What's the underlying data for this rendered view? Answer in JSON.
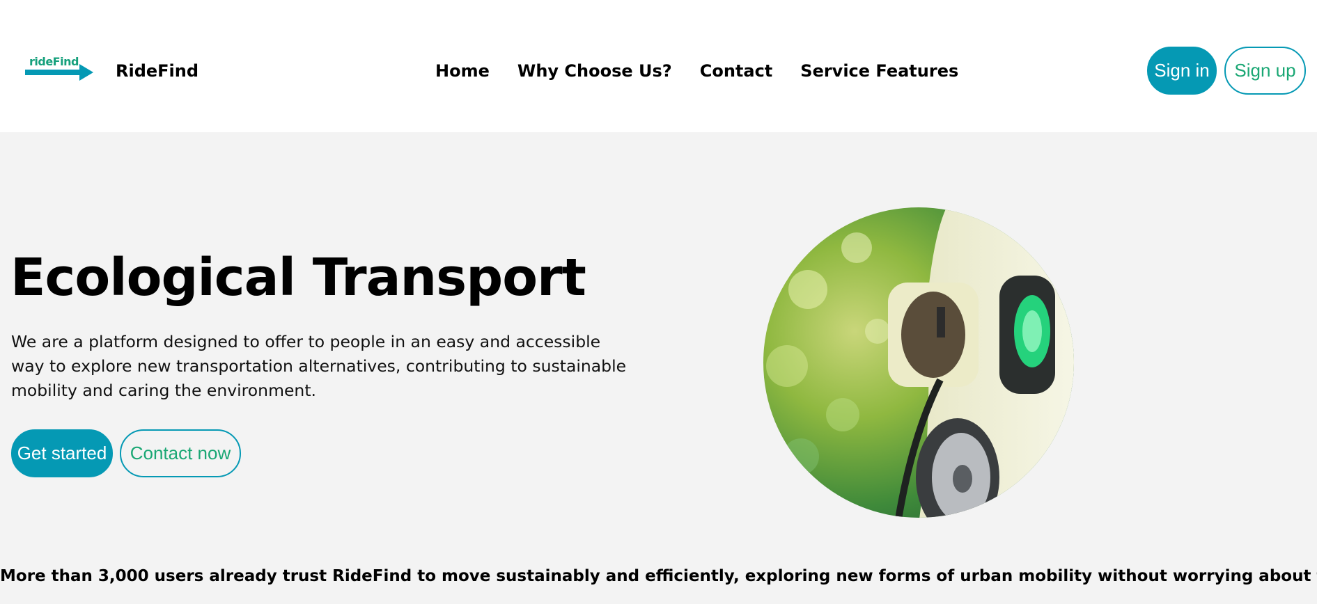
{
  "header": {
    "logo_text": "rideFind",
    "brand_name": "RideFind",
    "nav": [
      {
        "label": "Home"
      },
      {
        "label": "Why Choose Us?"
      },
      {
        "label": "Contact"
      },
      {
        "label": "Service Features"
      }
    ],
    "sign_in_label": "Sign in",
    "sign_up_label": "Sign up"
  },
  "hero": {
    "title": "Ecological Transport",
    "description": "We are a platform designed to offer to people in an easy and accessible way to explore new transportation alternatives, contributing to sustainable mobility and caring the environment.",
    "primary_cta": "Get started",
    "secondary_cta": "Contact now"
  },
  "trust_banner": "More than 3,000 users already trust RideFind to move sustainably and efficiently, exploring new forms of urban mobility without worrying about traffic.",
  "colors": {
    "brand_primary": "#0599b4",
    "brand_green": "#1aa774",
    "page_background": "#f3f3f3",
    "navbar_background": "#ffffff"
  },
  "icons": {
    "logo": "ridefind-arrow-logo",
    "hero_image": "ev-charging-photo"
  }
}
